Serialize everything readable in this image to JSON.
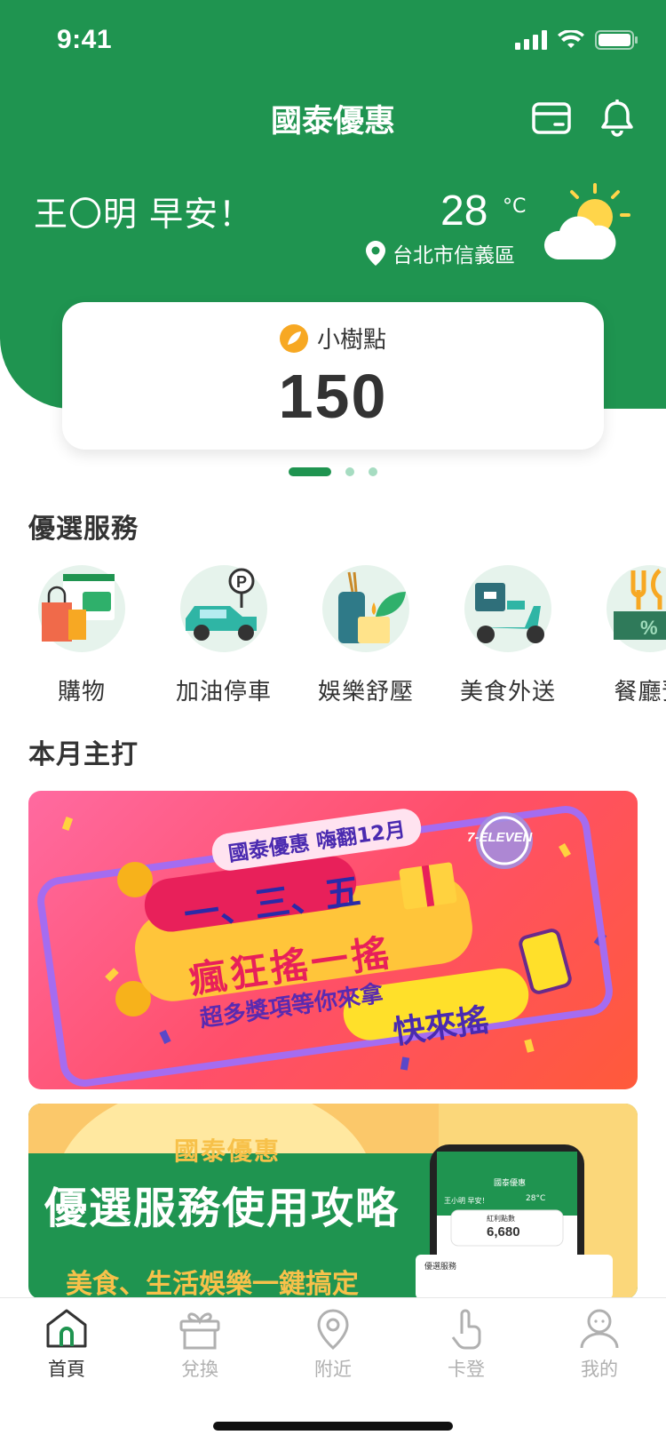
{
  "status": {
    "time": "9:41"
  },
  "header": {
    "title": "國泰優惠",
    "greeting": "王〇明 早安！",
    "temperature": "28",
    "temperature_unit": "°C",
    "location": "台北市信義區",
    "weather": "sun-cloud-icon"
  },
  "points": {
    "label": "小樹點",
    "value": "150"
  },
  "pager": {
    "count": 3,
    "active": 0
  },
  "services": {
    "title": "優選服務",
    "items": [
      {
        "label": "購物",
        "icon": "shopping-bag-icon"
      },
      {
        "label": "加油停車",
        "icon": "car-parking-icon"
      },
      {
        "label": "娛樂舒壓",
        "icon": "spa-candle-icon"
      },
      {
        "label": "美食外送",
        "icon": "delivery-scooter-icon"
      },
      {
        "label": "餐廳預",
        "icon": "restaurant-icon"
      }
    ]
  },
  "featured": {
    "title": "本月主打",
    "banner1": {
      "tag": "國泰優惠 嗨翻12月",
      "brand": "7-ELEVEN",
      "line1": "一、三、五",
      "line2": "瘋狂搖一搖",
      "line3": "超多獎項等你來拿",
      "cta": "快來搖"
    },
    "banner2": {
      "tag": "國泰優惠",
      "headline": "優選服務使用攻略",
      "subline": "美食、生活娛樂一鍵搞定",
      "phone_title": "國泰優惠",
      "phone_greeting": "王小明 早安！",
      "phone_temp": "28°C",
      "phone_points_label": "紅利點數",
      "phone_points": "6,680",
      "phone_section": "優選服務"
    }
  },
  "tabs": [
    {
      "label": "首頁",
      "icon": "home-icon",
      "active": true
    },
    {
      "label": "兌換",
      "icon": "gift-icon",
      "active": false
    },
    {
      "label": "附近",
      "icon": "location-pin-icon",
      "active": false
    },
    {
      "label": "卡登",
      "icon": "tap-finger-icon",
      "active": false
    },
    {
      "label": "我的",
      "icon": "user-icon",
      "active": false
    }
  ],
  "colors": {
    "brand_green": "#1f9450",
    "accent_light": "#a6dcc1"
  }
}
